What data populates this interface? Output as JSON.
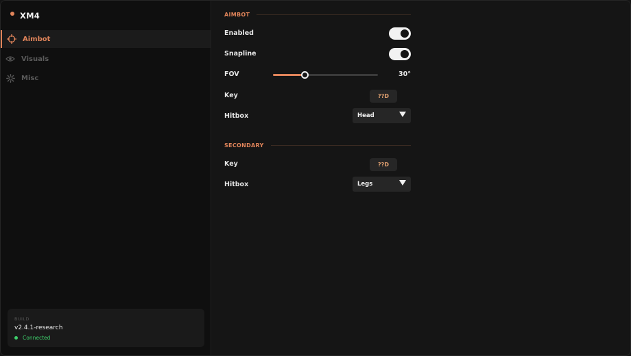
{
  "app": {
    "title": "XM4",
    "accent": "#e0845a"
  },
  "sidebar": {
    "items": [
      {
        "label": "Aimbot",
        "icon": "crosshair-icon",
        "active": true
      },
      {
        "label": "Visuals",
        "icon": "eye-icon",
        "active": false
      },
      {
        "label": "Misc",
        "icon": "gear-icon",
        "active": false
      }
    ],
    "build": {
      "label": "BUILD",
      "version": "v2.4.1-research",
      "status": "Connected",
      "status_color": "#3ecf6b"
    }
  },
  "aimbot": {
    "title": "AIMBOT",
    "enabled": {
      "label": "Enabled",
      "on": true
    },
    "snapline": {
      "label": "Snapline",
      "on": true
    },
    "fov": {
      "label": "FOV",
      "value": 30,
      "max": 100,
      "display": "30°"
    },
    "key": {
      "label": "Key",
      "value": "??D"
    },
    "hitbox": {
      "label": "Hitbox",
      "value": "Head"
    }
  },
  "secondary": {
    "title": "SECONDARY",
    "key": {
      "label": "Key",
      "value": "??D"
    },
    "hitbox": {
      "label": "Hitbox",
      "value": "Legs"
    }
  }
}
